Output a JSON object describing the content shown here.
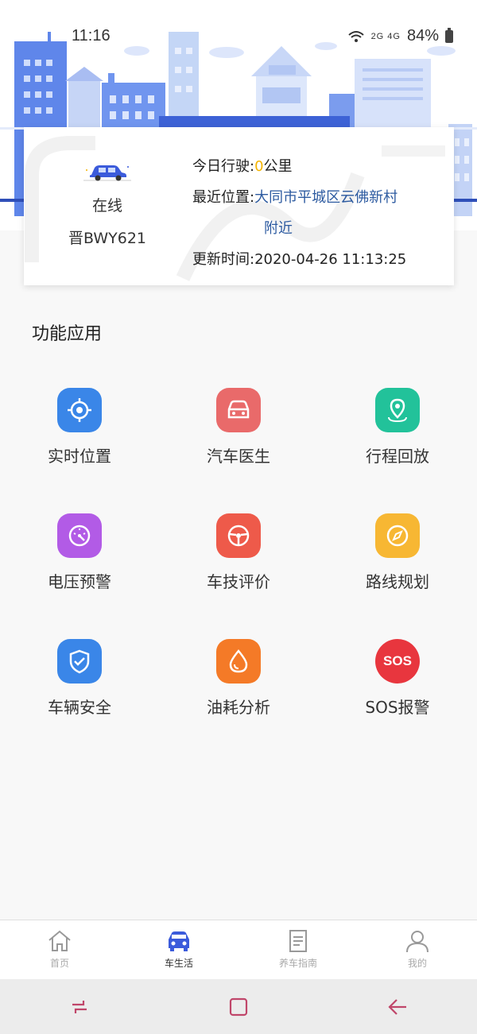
{
  "status_bar": {
    "time": "11:16",
    "signal": "2G 4G",
    "battery": "84%"
  },
  "vehicle": {
    "status": "在线",
    "plate": "晋BWY621",
    "today_label": "今日行驶:",
    "today_value": "0",
    "today_unit": "公里",
    "location_label": "最近位置:",
    "location_value": "大同市平城区云佛新村",
    "location_value_cont": "附近",
    "update_label": "更新时间:",
    "update_value": "2020-04-26 11:13:25"
  },
  "section_title": "功能应用",
  "features": [
    {
      "label": "实时位置",
      "icon": "locate-icon",
      "color": "#3a86e8"
    },
    {
      "label": "汽车医生",
      "icon": "car-doctor-icon",
      "color": "#e96a6a"
    },
    {
      "label": "行程回放",
      "icon": "trip-replay-icon",
      "color": "#22c29a"
    },
    {
      "label": "电压预警",
      "icon": "voltage-gauge-icon",
      "color": "#b25be6"
    },
    {
      "label": "车技评价",
      "icon": "steering-wheel-icon",
      "color": "#ee5a4a"
    },
    {
      "label": "路线规划",
      "icon": "compass-icon",
      "color": "#f7b733"
    },
    {
      "label": "车辆安全",
      "icon": "shield-icon",
      "color": "#3a86e8"
    },
    {
      "label": "油耗分析",
      "icon": "fuel-drop-icon",
      "color": "#f47a27"
    },
    {
      "label": "SOS报警",
      "icon": "sos-icon",
      "color": "#e8363e"
    }
  ],
  "sos_text": "SOS",
  "tabs": [
    {
      "label": "首页",
      "icon": "home-icon"
    },
    {
      "label": "车生活",
      "icon": "car-icon"
    },
    {
      "label": "养车指南",
      "icon": "guide-book-icon"
    },
    {
      "label": "我的",
      "icon": "profile-icon"
    }
  ],
  "active_tab": "车生活",
  "colors": {
    "accent": "#3b5bdb",
    "location_text": "#2c5aa0",
    "mileage_value": "#f4b400",
    "nav_icons": "#c0466a"
  }
}
